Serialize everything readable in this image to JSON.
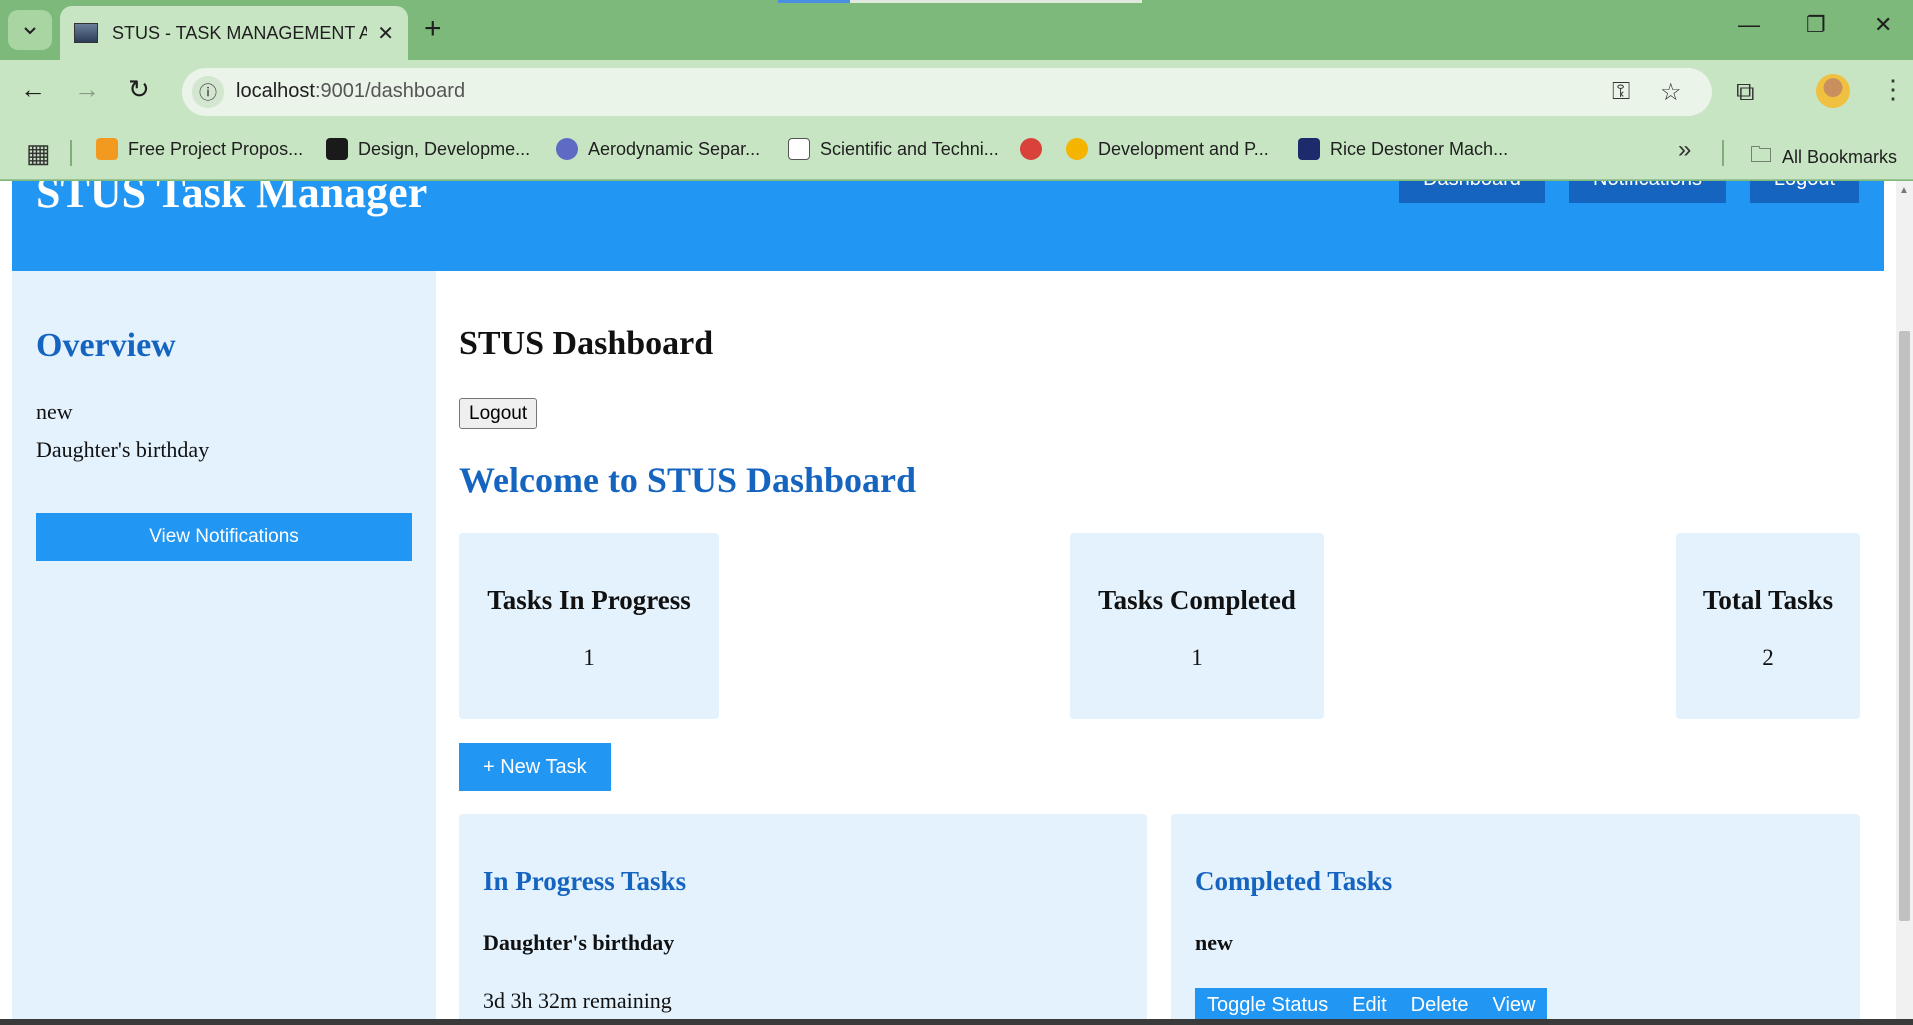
{
  "browser": {
    "tab_title": "STUS - TASK MANAGEMENT AP",
    "url_host": "localhost",
    "url_path": ":9001/dashboard",
    "bookmarks": [
      {
        "label": "Free Project Propos...",
        "color": "#f29a1f"
      },
      {
        "label": "Design, Developme...",
        "color": "#1a1a1a"
      },
      {
        "label": "Aerodynamic Separ...",
        "color": "#5d6bc4"
      },
      {
        "label": "Scientific and Techni...",
        "color": "#ffffff"
      },
      {
        "label": "",
        "color": "#d9413b"
      },
      {
        "label": "Development and P...",
        "color": "#f4b400"
      },
      {
        "label": "Rice Destoner Mach...",
        "color": "#1d2a6b"
      }
    ],
    "all_bookmarks": "All Bookmarks",
    "icons": {
      "new_tab": "+",
      "close": "✕",
      "back": "←",
      "forward": "→",
      "reload": "↻",
      "star": "☆",
      "more": "»",
      "menu": "⋮"
    }
  },
  "header": {
    "title": "STUS Task Manager",
    "nav": [
      "Dashboard",
      "Notifications",
      "Logout"
    ],
    "color": "#2196f3"
  },
  "sidebar": {
    "title": "Overview",
    "items": [
      "new",
      "Daughter's birthday"
    ],
    "button": "View Notifications"
  },
  "main": {
    "title": "STUS Dashboard",
    "logout_label": "Logout",
    "welcome": "Welcome to STUS Dashboard",
    "stats": [
      {
        "label": "Tasks In Progress",
        "value": "1"
      },
      {
        "label": "Tasks Completed",
        "value": "1"
      },
      {
        "label": "Total Tasks",
        "value": "2"
      }
    ],
    "new_task_label": "+ New Task",
    "in_progress": {
      "title": "In Progress Tasks",
      "task_name": "Daughter's birthday",
      "remaining": "3d 3h 32m remaining"
    },
    "completed": {
      "title": "Completed Tasks",
      "task_name": "new",
      "actions": [
        "Toggle Status",
        "Edit",
        "Delete",
        "View"
      ]
    }
  }
}
